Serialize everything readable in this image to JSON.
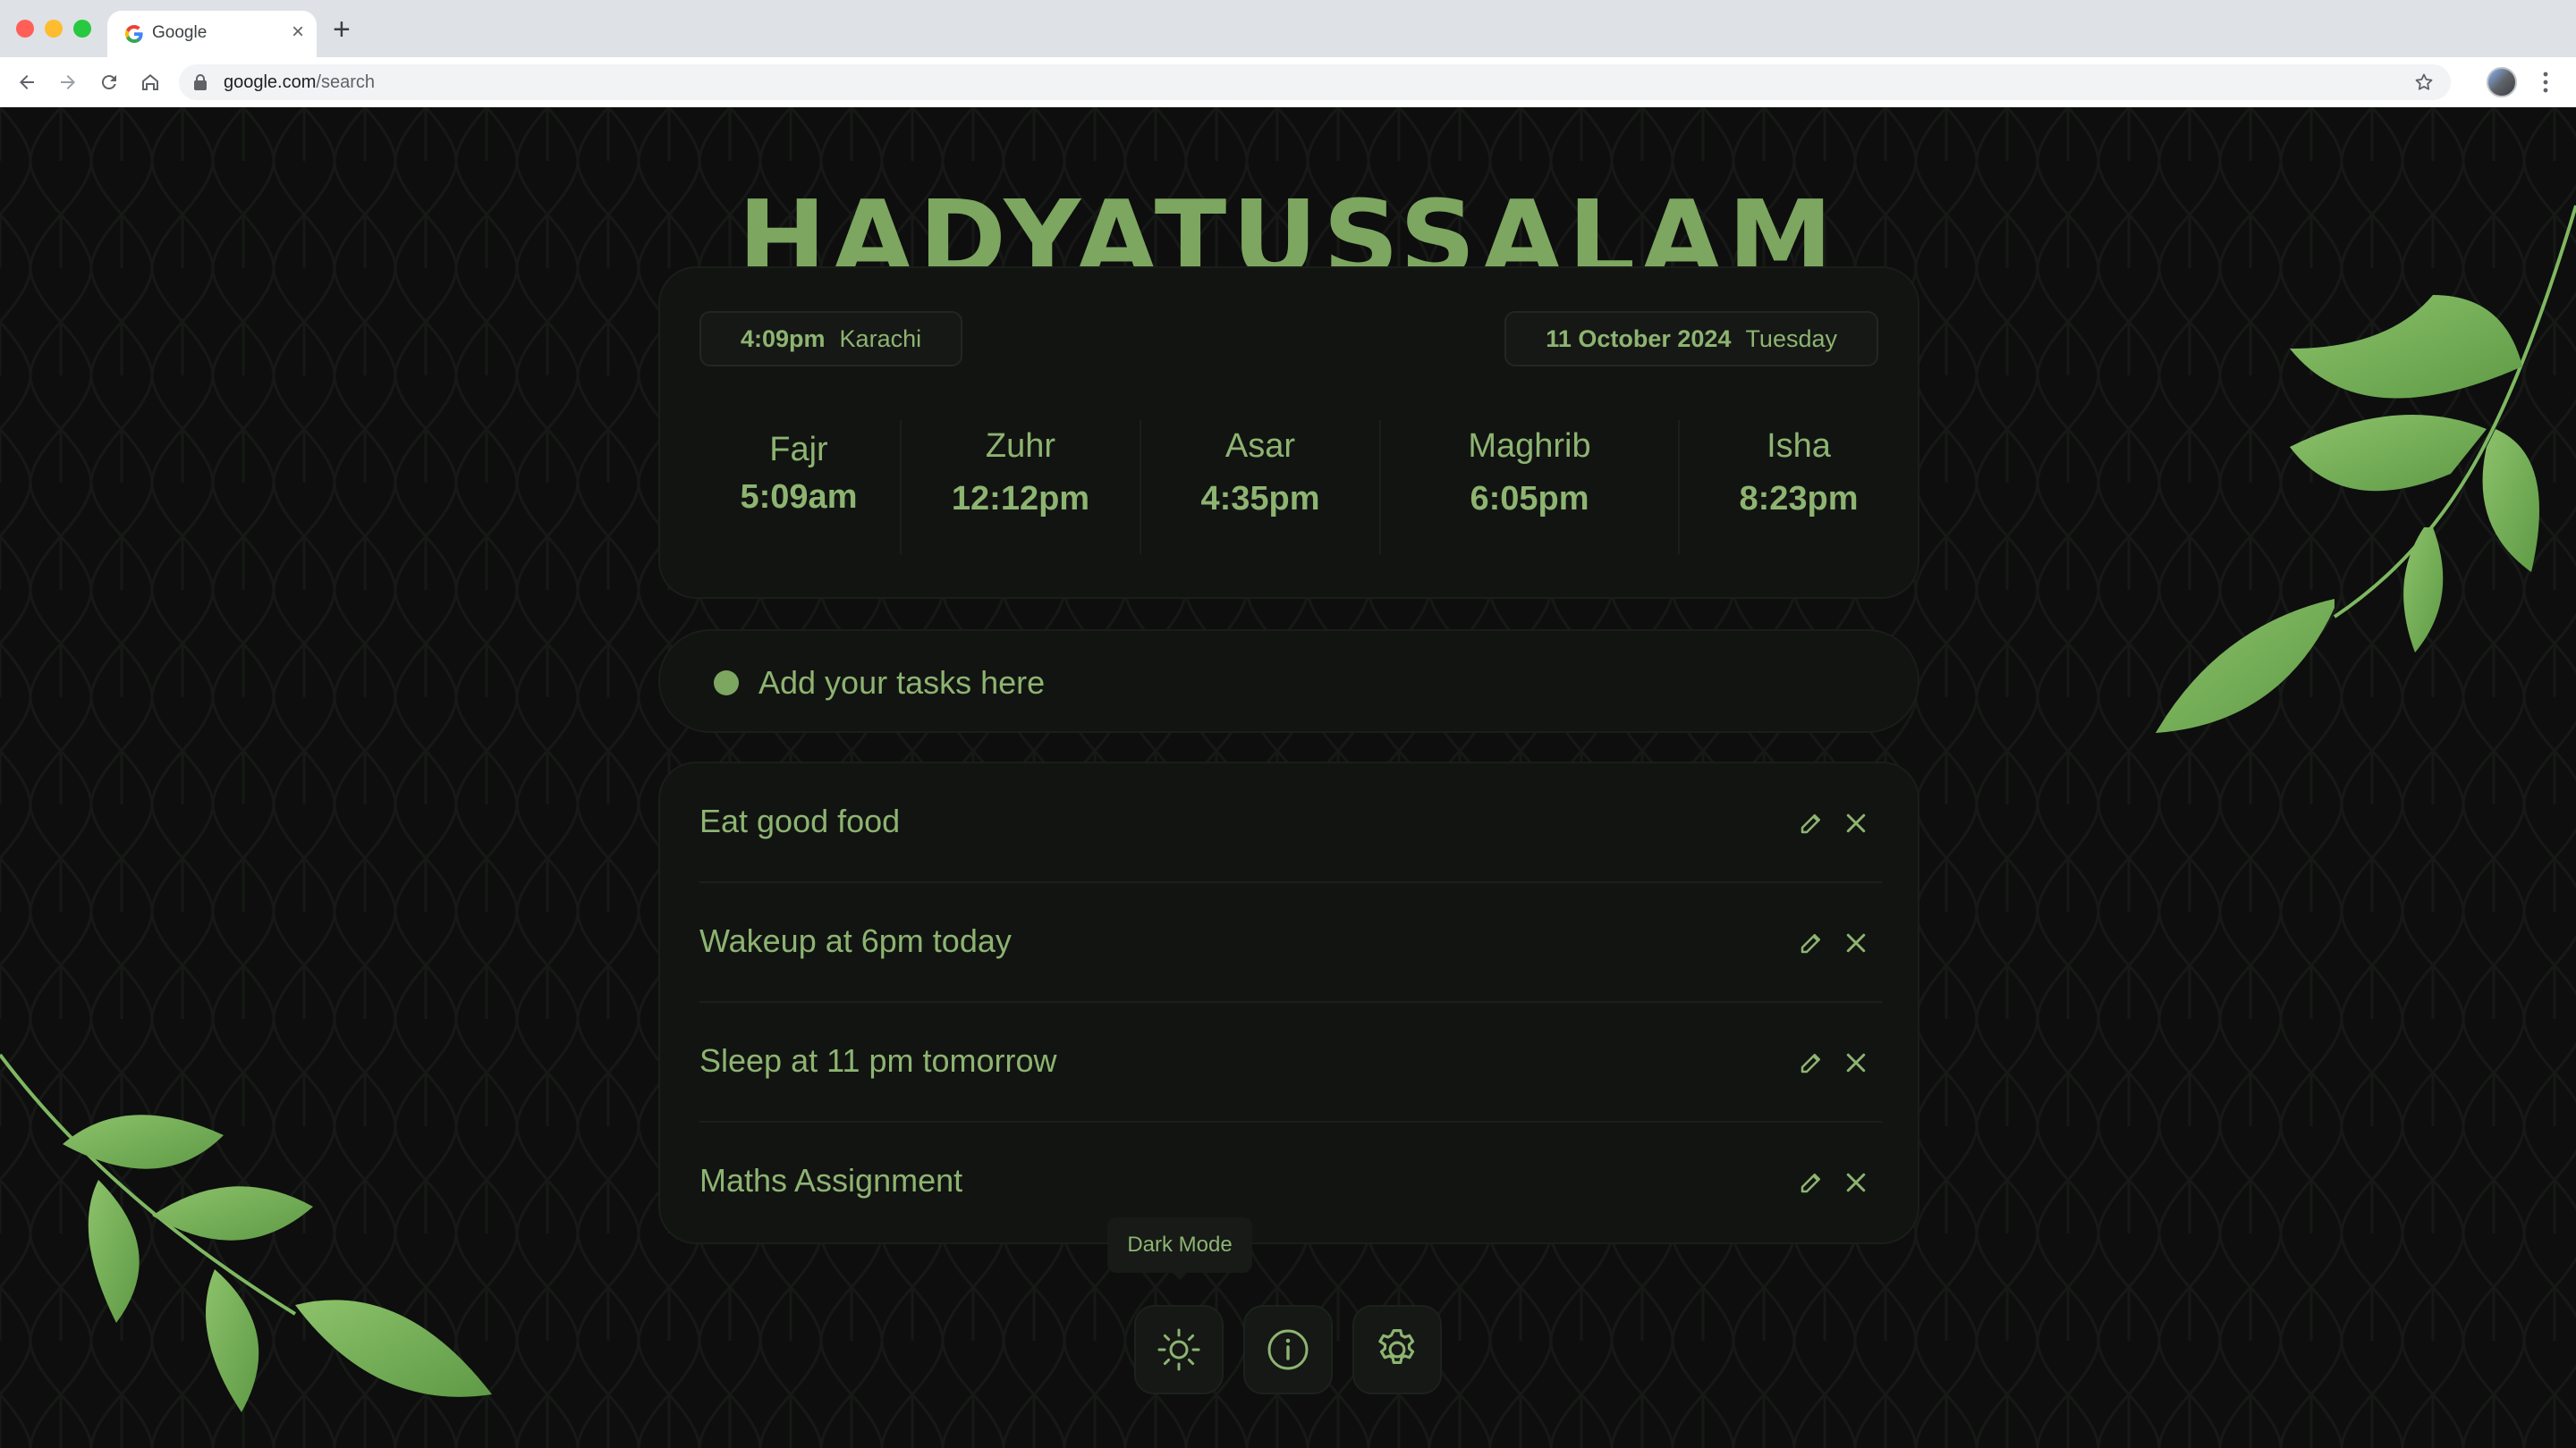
{
  "browser": {
    "tab_title": "Google",
    "url_host": "google.com",
    "url_path": "/search"
  },
  "app": {
    "title": "HADYATUSSALAM",
    "accent_color": "#7da660",
    "text_color": "#8db471",
    "current_time": "4:09pm",
    "city": "Karachi",
    "date": "11 October 2024",
    "weekday": "Tuesday",
    "prayers": [
      {
        "name": "Fajr",
        "time": "5:09am"
      },
      {
        "name": "Zuhr",
        "time": "12:12pm"
      },
      {
        "name": "Asar",
        "time": "4:35pm"
      },
      {
        "name": "Maghrib",
        "time": "6:05pm"
      },
      {
        "name": "Isha",
        "time": "8:23pm"
      }
    ],
    "task_input_placeholder": "Add your tasks here",
    "tasks": [
      {
        "text": "Eat good food"
      },
      {
        "text": "Wakeup at 6pm today"
      },
      {
        "text": "Sleep at 11 pm tomorrow"
      },
      {
        "text": "Maths Assignment"
      }
    ],
    "tooltip": "Dark Mode",
    "dock": [
      {
        "icon": "sun-icon"
      },
      {
        "icon": "info-icon"
      },
      {
        "icon": "settings-icon"
      }
    ]
  }
}
